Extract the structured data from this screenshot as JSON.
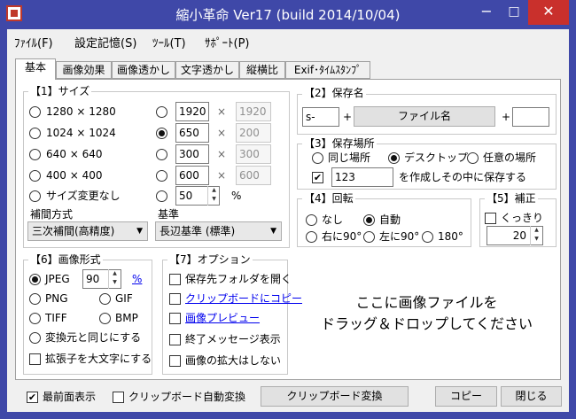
{
  "window": {
    "title": "縮小革命 Ver17 (build 2014/10/04)",
    "minimize": "−",
    "maximize": "□",
    "close": "✕"
  },
  "menu": [
    "ﾌｧｲﾙ(F)",
    "設定記憶(S)",
    "ﾂｰﾙ(T)",
    "ｻﾎﾟｰﾄ(P)"
  ],
  "tabs": [
    "基本",
    "画像効果",
    "画像透かし",
    "文字透かし",
    "縦横比",
    "Exif･ﾀｲﾑｽﾀﾝﾌﾟ"
  ],
  "size_group": {
    "label": "【1】サイズ",
    "presets": [
      "1280 × 1280",
      "1024 × 1024",
      "640 × 640",
      "400 × 400",
      "サイズ変更なし"
    ],
    "custom": [
      {
        "value": "1920",
        "alt": "1920"
      },
      {
        "value": "650",
        "alt": "200"
      },
      {
        "value": "300",
        "alt": "300"
      },
      {
        "value": "600",
        "alt": "600"
      }
    ],
    "times": "×",
    "percent_value": "50",
    "percent_sign": "%",
    "interp_label": "補間方式",
    "interp_value": "三次補間(高精度)",
    "base_label": "基準",
    "base_value": "長辺基準 (標準)"
  },
  "save_name": {
    "label": "【2】保存名",
    "prefix": "s-",
    "plus": "+",
    "button": "ファイル名",
    "suffix": ""
  },
  "save_place": {
    "label": "【3】保存場所",
    "options": [
      "同じ場所",
      "デスクトップ",
      "任意の場所"
    ],
    "folder": "123",
    "folder_text": "を作成しその中に保存する"
  },
  "rotate": {
    "label": "【4】回転",
    "options": [
      "なし",
      "自動",
      "右に90°",
      "左に90°",
      "180°"
    ]
  },
  "correct": {
    "label": "【5】補正",
    "sharp": "くっきり",
    "value": "20"
  },
  "format": {
    "label": "【6】画像形式",
    "jpeg": "JPEG",
    "quality": "90",
    "percent": "%",
    "png": "PNG",
    "gif": "GIF",
    "tiff": "TIFF",
    "bmp": "BMP",
    "same": "変換元と同じにする",
    "upper": "拡張子を大文字にする"
  },
  "options": {
    "label": "【7】オプション",
    "items": [
      "保存先フォルダを開く",
      "クリップボードにコピー",
      "画像プレビュー",
      "終了メッセージ表示",
      "画像の拡大はしない"
    ]
  },
  "drop": {
    "line1": "ここに画像ファイルを",
    "line2": "ドラッグ＆ドロップしてください"
  },
  "bottom": {
    "topmost": "最前面表示",
    "clip_auto": "クリップボード自動変換",
    "clip_convert": "クリップボード変換",
    "copy": "コピー",
    "close": "閉じる"
  }
}
